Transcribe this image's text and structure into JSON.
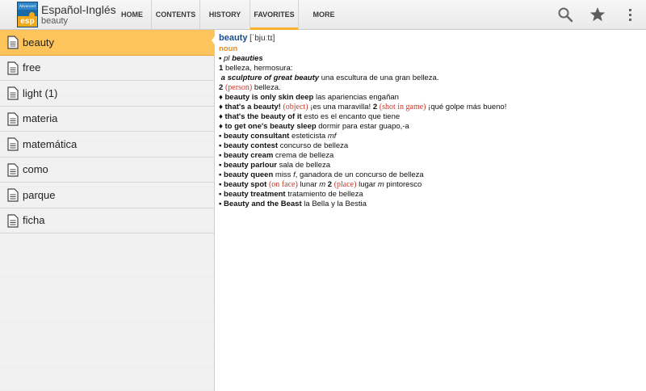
{
  "app": {
    "icon_top": "Advanced",
    "icon_bottom": "esp",
    "title": "Español-Inglés",
    "subtitle": "beauty"
  },
  "tabs": [
    {
      "label": "HOME",
      "active": false
    },
    {
      "label": "CONTENTS",
      "active": false
    },
    {
      "label": "HISTORY",
      "active": false
    },
    {
      "label": "FAVORITES",
      "active": true
    },
    {
      "label": "MORE",
      "active": false
    }
  ],
  "toolbar_icons": [
    "search-icon",
    "star-icon",
    "overflow-menu-icon"
  ],
  "colors": {
    "accent": "#f9b32b",
    "selected_row": "#fdc45c",
    "headword": "#1c4d8c",
    "pos": "#e48b1c",
    "label_red": "#c0392b"
  },
  "sidebar": {
    "items": [
      {
        "label": "beauty",
        "selected": true
      },
      {
        "label": "free"
      },
      {
        "label": "light (1)"
      },
      {
        "label": "materia"
      },
      {
        "label": "matemática"
      },
      {
        "label": "como"
      },
      {
        "label": "parque"
      },
      {
        "label": "ficha"
      }
    ]
  },
  "entry": {
    "headword": "beauty",
    "pronunciation": "[ˈbjuːtɪ]",
    "pos": "noun",
    "plural_marker": "pl",
    "plural": "beauties",
    "sense1_num": "1",
    "sense1_text": "belleza, hermosura:",
    "ex1_phrase": "a sculpture of great beauty",
    "ex1_trans": "una escultura de una gran belleza.",
    "sense2_num": "2",
    "sense2_label": "(person)",
    "sense2_text": "belleza.",
    "idioms": [
      {
        "phrase": "beauty is only skin deep",
        "trans": "las apariencias engañan"
      },
      {
        "phrase": "that's a beauty!",
        "label1": "(object)",
        "trans1": "¡es una maravilla!",
        "num2": "2",
        "label2": "(shot in game)",
        "trans2": "¡qué golpe más bueno!"
      },
      {
        "phrase": "that's the beauty of it",
        "trans": "esto es el encanto que tiene"
      },
      {
        "phrase": "to get one's beauty sleep",
        "trans": "dormir para estar guapo,-a"
      }
    ],
    "compounds": [
      {
        "phrase": "beauty consultant",
        "trans": "esteticista",
        "gender": "mf"
      },
      {
        "phrase": "beauty contest",
        "trans": "concurso de belleza"
      },
      {
        "phrase": "beauty cream",
        "trans": "crema de belleza"
      },
      {
        "phrase": "beauty parlour",
        "trans": "sala de belleza"
      },
      {
        "phrase": "beauty queen",
        "trans": "miss",
        "gender": "f",
        "trans_b": ", ganadora de un concurso de belleza"
      },
      {
        "phrase": "beauty spot",
        "label1": "(on face)",
        "trans": "lunar",
        "gender": "m",
        "num2": "2",
        "label2": "(place)",
        "trans2": "lugar",
        "gender2": "m",
        "trans2_b": "pintoresco"
      },
      {
        "phrase": "beauty treatment",
        "trans": "tratamiento de belleza"
      },
      {
        "phrase": "Beauty and the Beast",
        "trans": "la Bella y la Bestia"
      }
    ],
    "diamond": "♦",
    "bullet": "▪"
  }
}
